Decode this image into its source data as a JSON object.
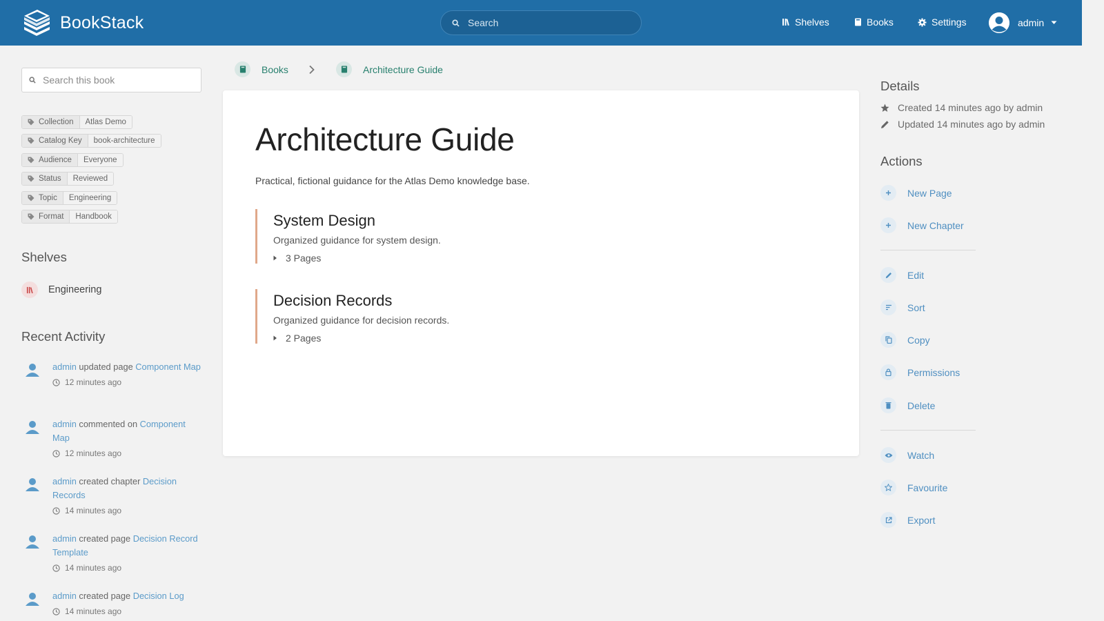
{
  "header": {
    "app_name": "BookStack",
    "search_placeholder": "Search",
    "nav": {
      "shelves": "Shelves",
      "books": "Books",
      "settings": "Settings"
    },
    "user": "admin"
  },
  "sidebar": {
    "search_placeholder": "Search this book",
    "tags": [
      {
        "name": "Collection",
        "value": "Atlas Demo"
      },
      {
        "name": "Catalog Key",
        "value": "book-architecture"
      },
      {
        "name": "Audience",
        "value": "Everyone"
      },
      {
        "name": "Status",
        "value": "Reviewed"
      },
      {
        "name": "Topic",
        "value": "Engineering"
      },
      {
        "name": "Format",
        "value": "Handbook"
      }
    ],
    "shelves_heading": "Shelves",
    "shelves": [
      "Engineering"
    ],
    "activity_heading": "Recent Activity",
    "activity": [
      {
        "user": "admin",
        "action": "updated page",
        "target": "Component Map",
        "time": "12 minutes ago"
      },
      {
        "user": "admin",
        "action": "commented on",
        "target": "Component Map",
        "time": "12 minutes ago"
      },
      {
        "user": "admin",
        "action": "created chapter",
        "target": "Decision Records",
        "time": "14 minutes ago"
      },
      {
        "user": "admin",
        "action": "created page",
        "target": "Decision Record Template",
        "time": "14 minutes ago"
      },
      {
        "user": "admin",
        "action": "created page",
        "target": "Decision Log",
        "time": "14 minutes ago"
      }
    ]
  },
  "breadcrumb": {
    "root": "Books",
    "current": "Architecture Guide"
  },
  "book": {
    "title": "Architecture Guide",
    "description": "Practical, fictional guidance for the Atlas Demo knowledge base.",
    "chapters": [
      {
        "title": "System Design",
        "description": "Organized guidance for system design.",
        "pages": "3 Pages"
      },
      {
        "title": "Decision Records",
        "description": "Organized guidance for decision records.",
        "pages": "2 Pages"
      }
    ]
  },
  "details": {
    "heading": "Details",
    "created": "Created 14 minutes ago by admin",
    "updated": "Updated 14 minutes ago by admin"
  },
  "actions": {
    "heading": "Actions",
    "new_page": "New Page",
    "new_chapter": "New Chapter",
    "edit": "Edit",
    "sort": "Sort",
    "copy": "Copy",
    "permissions": "Permissions",
    "delete": "Delete",
    "watch": "Watch",
    "favourite": "Favourite",
    "export": "Export"
  },
  "colors": {
    "header": "#206ea7",
    "link": "#4f8fc1",
    "book": "#28806e",
    "chapter": "#e0a88a",
    "shelf": "#c94a4a"
  }
}
